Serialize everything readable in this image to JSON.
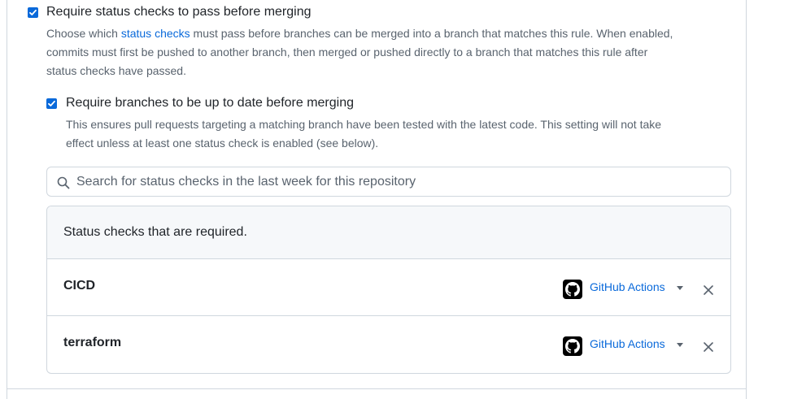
{
  "require_status_checks": {
    "checked": true,
    "label": "Require status checks to pass before merging",
    "desc_before_link": "Choose which ",
    "desc_link": "status checks",
    "desc_line1_rest": " must pass before branches can be merged into a branch that matches this rule. When enabled,",
    "desc_line2": "commits must first be pushed to another branch, then merged or pushed directly to a branch that matches this rule after",
    "desc_line3": "status checks have passed."
  },
  "require_up_to_date": {
    "checked": true,
    "label": "Require branches to be up to date before merging",
    "desc_line1": "This ensures pull requests targeting a matching branch have been tested with the latest code. This setting will not take",
    "desc_line2": "effect unless at least one status check is enabled (see below)."
  },
  "search": {
    "placeholder": "Search for status checks in the last week for this repository"
  },
  "required_checks": {
    "header": "Status checks that are required.",
    "items": [
      {
        "name": "CICD",
        "app": "GitHub Actions"
      },
      {
        "name": "terraform",
        "app": "GitHub Actions"
      }
    ]
  },
  "colors": {
    "accent": "#0969da",
    "border": "#d0d7de",
    "muted_text": "#59636e",
    "header_bg": "#f6f8fa"
  },
  "icons": [
    "checkbox-checked-icon",
    "search-icon",
    "github-logo-icon",
    "caret-down-icon",
    "close-icon"
  ]
}
